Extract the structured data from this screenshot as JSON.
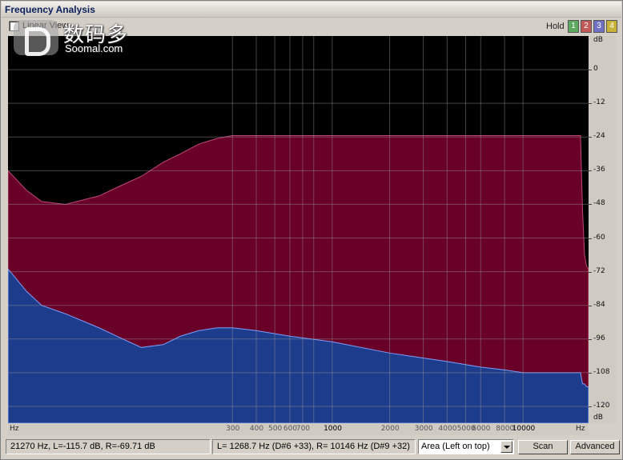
{
  "window": {
    "title": "Frequency Analysis"
  },
  "toolbar": {
    "linear_view_label": "Linear View",
    "linear_view_checked": false,
    "hold_label": "Hold",
    "hold_buttons": [
      "1",
      "2",
      "3",
      "4"
    ],
    "hold_colors": [
      "#5ea860",
      "#c25a5a",
      "#7070c4",
      "#c8b23a"
    ]
  },
  "watermark": {
    "cn": "数码多",
    "en": "Soomal.com"
  },
  "chart_data": {
    "type": "area",
    "xscale": "log",
    "xlim": [
      20,
      22050
    ],
    "ylim": [
      -126,
      12
    ],
    "y_unit": "dB",
    "x_unit": "Hz",
    "grid": true,
    "y_ticks": [
      -120,
      -108,
      -96,
      -84,
      -72,
      -60,
      -48,
      -36,
      -24,
      -12,
      0
    ],
    "x_ticks": [
      300,
      400,
      500,
      600,
      700,
      800,
      1000,
      2000,
      3000,
      4000,
      5000,
      6000,
      8000,
      10000
    ],
    "x_tick_labels": [
      "300",
      "400",
      "500",
      "600",
      "700",
      "1000",
      "2000",
      "3000",
      "4000",
      "5000",
      "6000",
      "8000",
      "10000"
    ],
    "series": [
      {
        "color": "#680028",
        "x": [
          20,
          25,
          30,
          40,
          60,
          80,
          100,
          130,
          160,
          200,
          250,
          300,
          400,
          500,
          1000,
          5000,
          15000,
          20000,
          20500,
          21000,
          21500,
          22050
        ],
        "values": [
          -36,
          -43,
          -47,
          -48,
          -45,
          -41,
          -38,
          -33,
          -30,
          -26.5,
          -24.5,
          -23.5,
          -23.5,
          -23.5,
          -23.5,
          -23.5,
          -23.5,
          -23.5,
          -50,
          -66,
          -70,
          -71
        ]
      },
      {
        "color": "#1e3c8c",
        "x": [
          20,
          25,
          30,
          40,
          60,
          80,
          100,
          130,
          160,
          200,
          250,
          300,
          400,
          600,
          1000,
          2000,
          4000,
          6000,
          8000,
          10000,
          15000,
          20000,
          20500,
          21000,
          21500,
          22050
        ],
        "values": [
          -71,
          -79,
          -84,
          -87,
          -92,
          -96,
          -99,
          -98,
          -95,
          -93,
          -92,
          -92,
          -93,
          -95,
          -97,
          -101,
          -104,
          -106,
          -107,
          -108,
          -108,
          -108,
          -112,
          -112,
          -113,
          -113
        ]
      }
    ]
  },
  "yaxis": {
    "unit_top": "dB",
    "unit_bottom": "dB"
  },
  "xaxis": {
    "unit_left": "Hz",
    "unit_right": "Hz"
  },
  "status": {
    "cursor_readout": "21270 Hz, L=-115.7 dB, R=-69.71 dB",
    "peak_readout": "L= 1268.7 Hz (D#6 +33), R=  10146 Hz (D#9 +32)",
    "view_mode": "Area (Left on top)",
    "scan_label": "Scan",
    "advanced_label": "Advanced"
  }
}
